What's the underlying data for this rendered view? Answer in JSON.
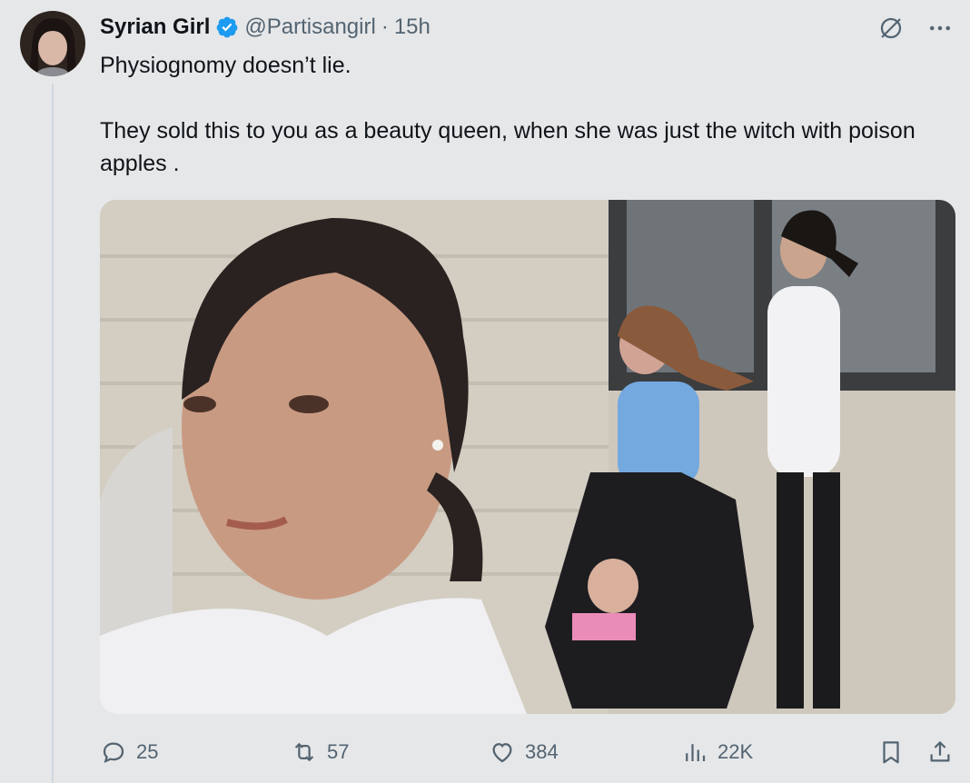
{
  "tweet": {
    "author_name": "Syrian Girl",
    "handle": "@Partisangirl",
    "separator": "·",
    "time": "15h",
    "text_line1": "Physiognomy doesn’t lie.",
    "text_line2": "They sold this to you as a beauty queen, when she was just the witch with poison apples ."
  },
  "icons": {
    "verified": "verified-badge-icon",
    "grok": "grok-icon",
    "more": "more-icon",
    "reply": "reply-icon",
    "retweet": "retweet-icon",
    "like": "like-icon",
    "views": "views-icon",
    "bookmark": "bookmark-icon",
    "share": "share-icon"
  },
  "stats": {
    "replies": "25",
    "retweets": "57",
    "likes": "384",
    "views": "22K"
  },
  "colors": {
    "background": "#e6e7e9",
    "text": "#0f1419",
    "secondary": "#536471",
    "verified": "#1d9bf0"
  }
}
